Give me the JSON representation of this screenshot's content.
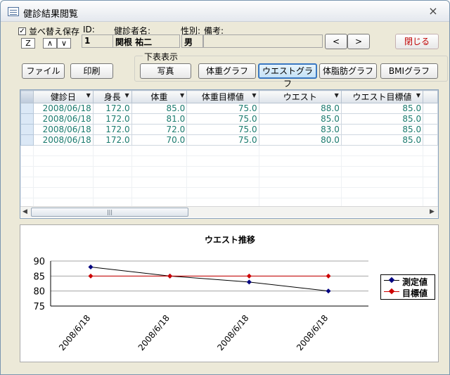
{
  "window": {
    "title": "健診結果閲覧",
    "close_glyph": "×"
  },
  "header": {
    "sort_save_label": "並べ替え保存",
    "sort_checked": "✓",
    "z_button": "Z",
    "up_button": "∧",
    "down_button": "∨",
    "id_label": "ID:",
    "id_value": "1",
    "name_label": "健診者名:",
    "name_value": "関根 祐二",
    "gender_label": "性別:",
    "gender_value": "男",
    "note_label": "備考:",
    "note_value": "",
    "prev_button": "<",
    "next_button": ">",
    "close_button": "閉じる"
  },
  "toolbar": {
    "file_button": "ファイル",
    "print_button": "印刷",
    "lower_display_label": "下表表示",
    "photo_button": "写真",
    "weight_graph_button": "体重グラフ",
    "waist_graph_button": "ウエストグラフ",
    "bodyfat_graph_button": "体脂肪グラフ",
    "bmi_graph_button": "BMIグラフ"
  },
  "table": {
    "columns": [
      "健診日",
      "身長",
      "体重",
      "体重目標値",
      "ウエスト",
      "ウエスト目標値"
    ],
    "rows": [
      [
        "2008/06/18",
        "172.0",
        "85.0",
        "75.0",
        "88.0",
        "85.0"
      ],
      [
        "2008/06/18",
        "172.0",
        "81.0",
        "75.0",
        "85.0",
        "85.0"
      ],
      [
        "2008/06/18",
        "172.0",
        "72.0",
        "75.0",
        "83.0",
        "85.0"
      ],
      [
        "2008/06/18",
        "172.0",
        "70.0",
        "75.0",
        "80.0",
        "85.0"
      ]
    ],
    "scroll_left": "◀",
    "scroll_right": "▶",
    "scroll_thumb": "|||"
  },
  "chart_data": {
    "type": "line",
    "title": "ウエスト推移",
    "categories": [
      "2008/6/18",
      "2008/6/18",
      "2008/6/18",
      "2008/6/18"
    ],
    "ylim": [
      75,
      90
    ],
    "yticks": [
      "90",
      "85",
      "80",
      "75"
    ],
    "grid": true,
    "legend_position": "right",
    "series": [
      {
        "name": "測定値",
        "values": [
          88,
          85,
          83,
          80
        ],
        "color": "#000000",
        "marker_color": "#000080"
      },
      {
        "name": "目標値",
        "values": [
          85,
          85,
          85,
          85
        ],
        "color": "#cc0000",
        "marker_color": "#cc0000"
      }
    ]
  }
}
